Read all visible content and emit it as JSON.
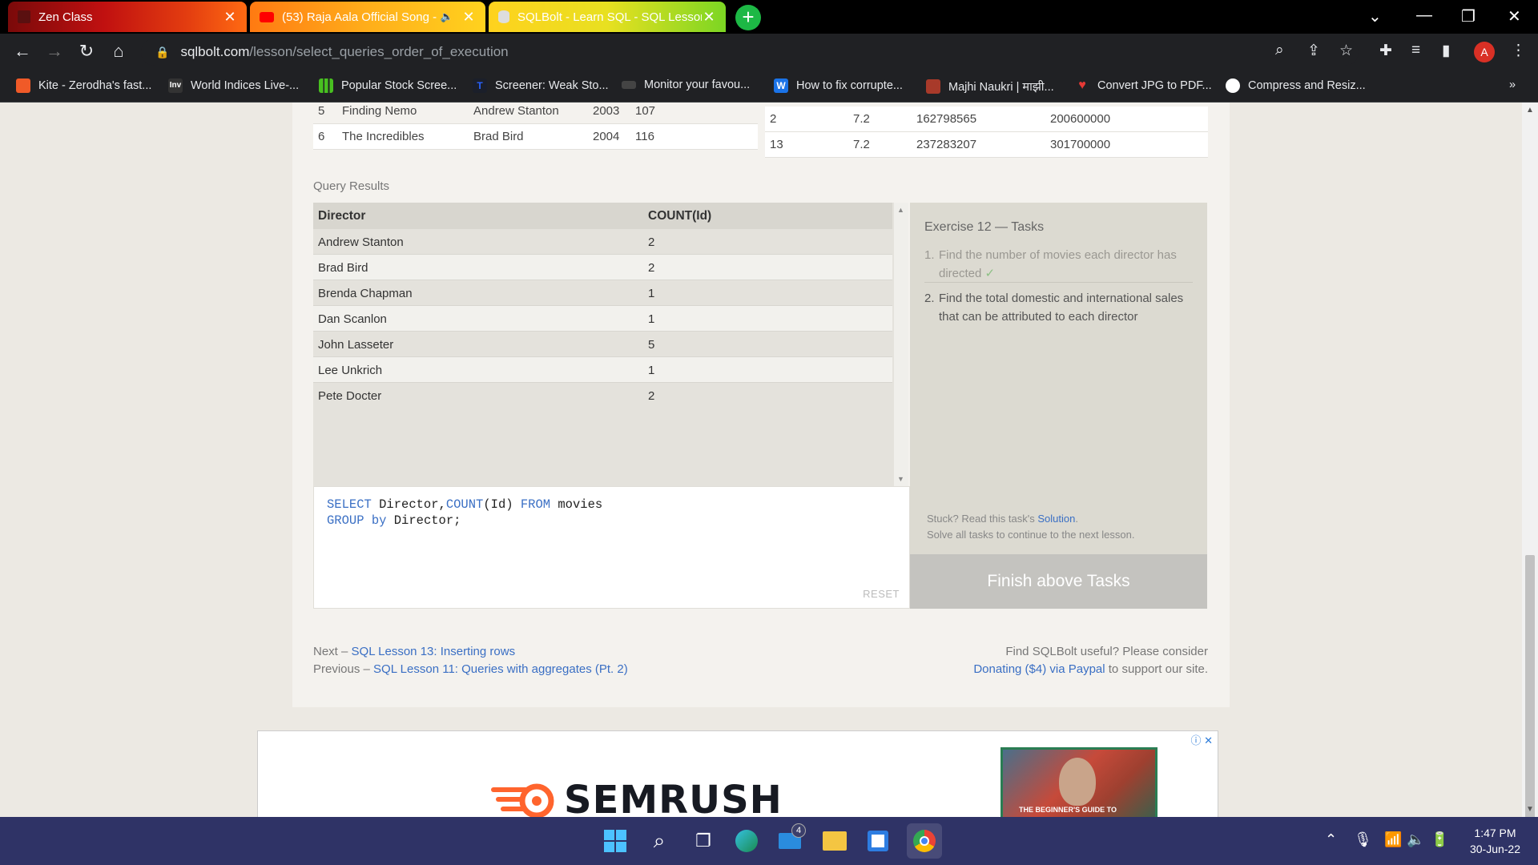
{
  "tabs": [
    {
      "title": "Zen Class",
      "close": "✕"
    },
    {
      "title": "(53) Raja Aala Official Song -",
      "close": "✕"
    },
    {
      "title": "SQLBolt - Learn SQL - SQL Lesson",
      "close": "✕"
    }
  ],
  "new_tab": "+",
  "address": {
    "host": "sqlbolt.com",
    "path": "/lesson/select_queries_order_of_execution"
  },
  "profile_initial": "A",
  "bookmarks": [
    {
      "label": "Kite - Zerodha's fast...",
      "icon": "kite-icon",
      "color": "#f05a28"
    },
    {
      "label": "World Indices Live-...",
      "icon": "investing-icon",
      "color": "#333333"
    },
    {
      "label": "Popular Stock Scree...",
      "icon": "bars-icon",
      "color": "#48c020"
    },
    {
      "label": "Screener: Weak Sto...",
      "icon": "tradingview-icon",
      "color": "#1b1f2a"
    },
    {
      "label": "Monitor your favou...",
      "icon": "monitor-icon",
      "color": "#444444"
    },
    {
      "label": "How to fix corrupte...",
      "icon": "w-icon",
      "color": "#1a73e8"
    },
    {
      "label": "Majhi Naukri | माझी...",
      "icon": "naukri-icon",
      "color": "#a83a2a"
    },
    {
      "label": "Convert JPG to PDF...",
      "icon": "heart-icon",
      "color": "#e53935"
    },
    {
      "label": "Compress and Resiz...",
      "icon": "compress-icon",
      "color": "#ffffff"
    }
  ],
  "top_table_left": [
    {
      "id": "5",
      "title": "Finding Nemo",
      "director": "Andrew Stanton",
      "year": "2003",
      "length": "107"
    },
    {
      "id": "6",
      "title": "The Incredibles",
      "director": "Brad Bird",
      "year": "2004",
      "length": "116"
    }
  ],
  "top_table_right": [
    {
      "id": "2",
      "rating": "7.2",
      "domestic": "162798565",
      "intl": "200600000"
    },
    {
      "id": "13",
      "rating": "7.2",
      "domestic": "237283207",
      "intl": "301700000"
    }
  ],
  "query_results": {
    "label": "Query Results",
    "columns": [
      "Director",
      "COUNT(Id)"
    ],
    "rows": [
      [
        "Andrew Stanton",
        "2"
      ],
      [
        "Brad Bird",
        "2"
      ],
      [
        "Brenda Chapman",
        "1"
      ],
      [
        "Dan Scanlon",
        "1"
      ],
      [
        "John Lasseter",
        "5"
      ],
      [
        "Lee Unkrich",
        "1"
      ],
      [
        "Pete Docter",
        "2"
      ]
    ]
  },
  "editor": {
    "line1_kw1": "SELECT",
    "line1_mid": " Director,",
    "line1_kw2": "COUNT",
    "line1_mid2": "(Id) ",
    "line1_kw3": "FROM",
    "line1_end": " movies",
    "line2_kw1": "GROUP",
    "line2_sp": " ",
    "line2_kw2": "by",
    "line2_end": " Director;",
    "reset": "RESET"
  },
  "tasks": {
    "title": "Exercise 12 — Tasks",
    "items": [
      {
        "num": "1.",
        "text": "Find the number of movies each director has directed",
        "check": "✓"
      },
      {
        "num": "2.",
        "text": "Find the total domestic and international sales that can be attributed to each director"
      }
    ],
    "stuck_prefix": "Stuck? Read this task's ",
    "solution": "Solution",
    "stuck_suffix": ".",
    "solve_all": "Solve all tasks to continue to the next lesson.",
    "finish": "Finish above Tasks"
  },
  "footer": {
    "next_prefix": "Next – ",
    "next_link": "SQL Lesson 13: Inserting rows",
    "prev_prefix": "Previous – ",
    "prev_link": "SQL Lesson 11: Queries with aggregates (Pt. 2)",
    "useful": "Find SQLBolt useful? Please consider",
    "donate_link": "Donating ($4) via Paypal",
    "donate_suffix": " to support our site."
  },
  "ad": {
    "brand": "SEMRUSH",
    "photo_caption": "THE BEGINNER'S GUIDE TO",
    "adchoice": "ⓘ ✕"
  },
  "taskbar": {
    "time": "1:47 PM",
    "date": "30-Jun-22",
    "mail_badge": "4"
  },
  "colors": {
    "link": "#3a6fc4",
    "task_bg": "#dcdad1",
    "taskbar": "#2f3366"
  }
}
